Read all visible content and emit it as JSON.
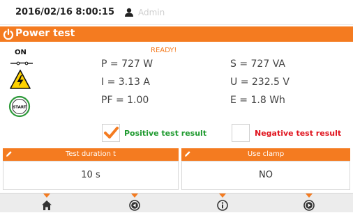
{
  "header": {
    "datetime": "2016/02/16 8:00:15",
    "user": "Admin"
  },
  "title": "Power test",
  "status": {
    "on_label": "ON",
    "ready": "READY!"
  },
  "measurements": {
    "p": "P = 727 W",
    "i": "I = 3.13 A",
    "pf": "PF = 1.00",
    "s": "S = 727 VA",
    "u": "U = 232.5 V",
    "e": "E = 1.8 Wh"
  },
  "results": {
    "positive_label": "Positive test result",
    "negative_label": "Negative test result",
    "positive_checked": true,
    "negative_checked": false
  },
  "params": [
    {
      "label": "Test duration t",
      "value": "10 s"
    },
    {
      "label": "Use clamp",
      "value": "NO"
    }
  ],
  "nav": [
    "home-icon",
    "back-icon",
    "info-icon",
    "forward-icon"
  ],
  "colors": {
    "accent": "#f47b20",
    "positive": "#1f9a2f",
    "negative": "#e0141e"
  }
}
